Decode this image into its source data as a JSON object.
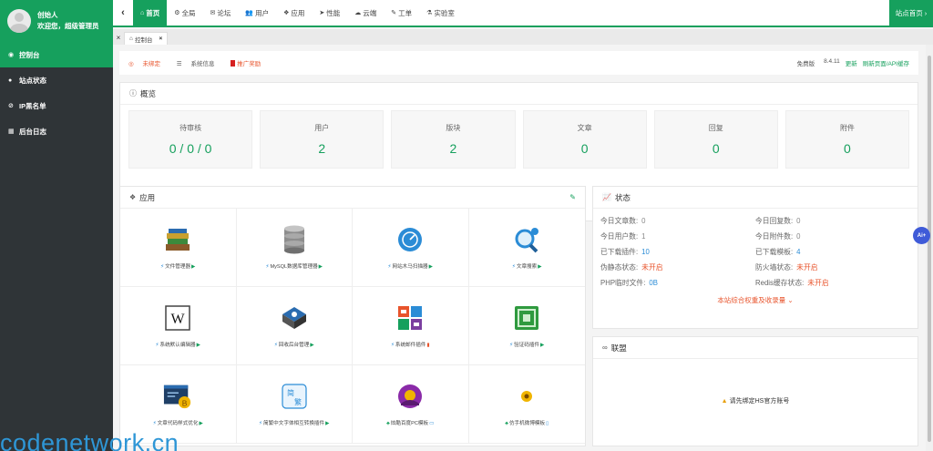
{
  "user": {
    "name": "创始人",
    "greeting": "欢迎您，超级管理员"
  },
  "sidebar": {
    "items": [
      {
        "icon": "dashboard-icon",
        "glyph": "◉",
        "label": "控制台",
        "active": true
      },
      {
        "icon": "site-status-icon",
        "glyph": "●",
        "label": "站点状态"
      },
      {
        "icon": "ban-icon",
        "glyph": "⊘",
        "label": "IP黑名单"
      },
      {
        "icon": "calendar-icon",
        "glyph": "▦",
        "label": "后台日志"
      }
    ]
  },
  "topnav": {
    "collapse_glyph": "‹",
    "items": [
      {
        "icon": "home-icon",
        "glyph": "⌂",
        "label": "首页",
        "active": true
      },
      {
        "icon": "gears-icon",
        "glyph": "⚙",
        "label": "全局"
      },
      {
        "icon": "comments-icon",
        "glyph": "✉",
        "label": "论坛"
      },
      {
        "icon": "users-icon",
        "glyph": "👥",
        "label": "用户"
      },
      {
        "icon": "cubes-icon",
        "glyph": "❖",
        "label": "应用"
      },
      {
        "icon": "paper-plane-icon",
        "glyph": "➤",
        "label": "性能"
      },
      {
        "icon": "cloud-icon",
        "glyph": "☁",
        "label": "云端"
      },
      {
        "icon": "wrench-icon",
        "glyph": "✎",
        "label": "工单"
      },
      {
        "icon": "flask-icon",
        "glyph": "⚗",
        "label": "实验室"
      }
    ],
    "home_button": "站点首页 ›"
  },
  "tabs": {
    "close_all": "×",
    "active_tab": {
      "glyph": "⌂",
      "label": "控制台",
      "close": "×"
    }
  },
  "infobar": {
    "unbound": "未绑定",
    "sysinfo": "系统信息",
    "promo": "推广奖励",
    "edition": "免费版",
    "version": "8.4.11",
    "update": "更新",
    "refresh": "刷新页面/API缓存"
  },
  "overview": {
    "title": "概览",
    "stats": [
      {
        "label": "待审核",
        "value": "0 / 0 / 0"
      },
      {
        "label": "用户",
        "value": "2"
      },
      {
        "label": "版块",
        "value": "2"
      },
      {
        "label": "文章",
        "value": "0"
      },
      {
        "label": "回复",
        "value": "0"
      },
      {
        "label": "附件",
        "value": "0"
      }
    ]
  },
  "apps": {
    "title": "应用",
    "items": [
      {
        "icon": "books-icon",
        "label": "文件管理器",
        "arrow": "▶",
        "arrow_color": "green"
      },
      {
        "icon": "database-icon",
        "label": "MySQL数据库管理器",
        "arrow": "▶",
        "arrow_color": "green"
      },
      {
        "icon": "scanner-icon",
        "label": "网站木马扫描器",
        "arrow": "▶",
        "arrow_color": "green"
      },
      {
        "icon": "magnifier-icon",
        "label": "文章搜索",
        "arrow": "▶",
        "arrow_color": "green"
      },
      {
        "icon": "wikipedia-icon",
        "label": "系统默认编辑器",
        "arrow": "▶",
        "arrow_color": "green"
      },
      {
        "icon": "admin-box-icon",
        "label": "回收后台管理",
        "arrow": "▶",
        "arrow_color": "green"
      },
      {
        "icon": "mail-plugin-icon",
        "label": "系统邮件插件",
        "arrow": "▮",
        "arrow_color": "red"
      },
      {
        "icon": "captcha-icon",
        "label": "验证码插件",
        "arrow": "▶",
        "arrow_color": "green"
      },
      {
        "icon": "code-icon",
        "label": "文章代码样式优化",
        "arrow": "▶",
        "arrow_color": "green"
      },
      {
        "icon": "translate-icon",
        "label": "简繁中文字体相互转换插件",
        "arrow": "▶",
        "arrow_color": "green"
      },
      {
        "icon": "baidu-theme-icon",
        "label": "炫酷百度PC模板",
        "arrow": "▭",
        "arrow_color": "blue"
      },
      {
        "icon": "mobile-theme-icon",
        "label": "仿手机微博模板",
        "arrow": "▯",
        "arrow_color": "blue"
      }
    ]
  },
  "status": {
    "title": "状态",
    "rows": [
      {
        "k": "今日文章数:",
        "v": "0",
        "c": "gray"
      },
      {
        "k": "今日回复数:",
        "v": "0",
        "c": "gray"
      },
      {
        "k": "今日用户数:",
        "v": "1",
        "c": "gray"
      },
      {
        "k": "今日附件数:",
        "v": "0",
        "c": "gray"
      },
      {
        "k": "已下载插件:",
        "v": "10",
        "c": "blue"
      },
      {
        "k": "已下载模板:",
        "v": "4",
        "c": "blue"
      },
      {
        "k": "伪静态状态:",
        "v": "未开启",
        "c": "red"
      },
      {
        "k": "防火墙状态:",
        "v": "未开启",
        "c": "red"
      },
      {
        "k": "PHP临时文件:",
        "v": "0B",
        "c": "blue"
      },
      {
        "k": "Redis缓存状态:",
        "v": "未开启",
        "c": "red"
      }
    ],
    "link": "本站综合权重及收录量 ⌄"
  },
  "alliance": {
    "title": "联盟",
    "notice": "请先绑定HS官方账号"
  },
  "ai_badge": "Ai+",
  "watermark": "codenetwork.cn",
  "colors": {
    "accent": "#16a05d",
    "sidebar": "#2f3437",
    "red": "#e8542c",
    "blue": "#2b8cd6"
  }
}
